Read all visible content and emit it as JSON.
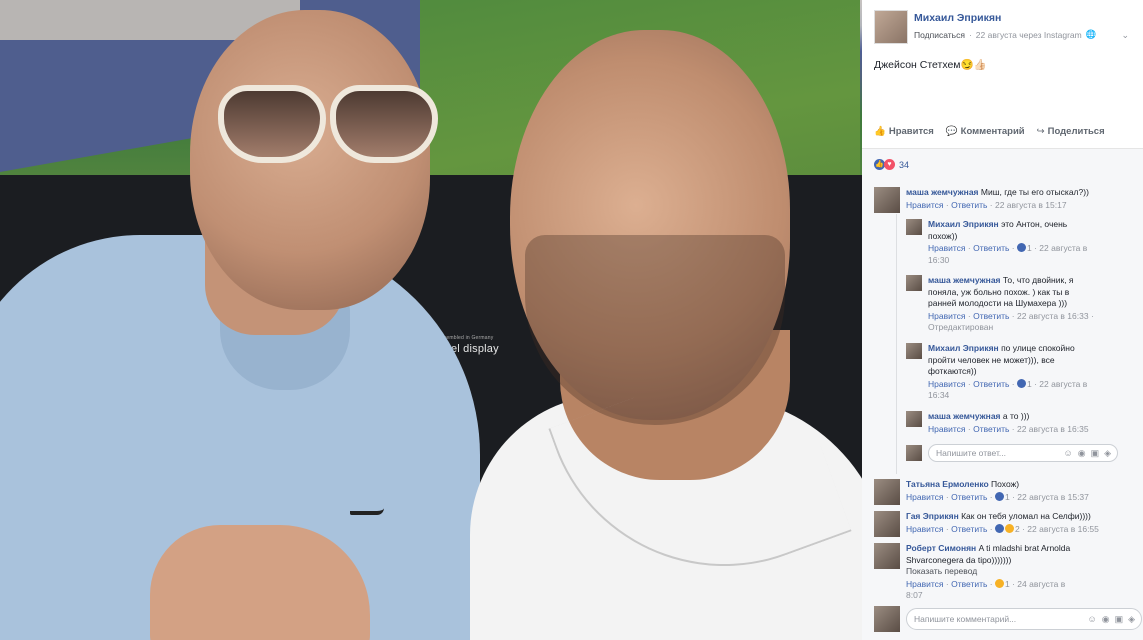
{
  "photo": {
    "screen_brand_small": "assembled in Germany",
    "screen_brand": "engel display"
  },
  "post": {
    "author": "Михаил Эприкян",
    "subscribe": "Подписаться",
    "meta_time": "22 августа через Instagram",
    "meta_sep": "·",
    "text": "Джейсон Стетхем😏👍🏻",
    "like_label": "Нравится",
    "comment_label": "Комментарий",
    "share_label": "Поделиться",
    "likes_count": "34"
  },
  "comments": [
    {
      "who": "маша жемчужная",
      "text": "Миш, где ты его отыскал?))",
      "like": "Нравится",
      "reply": "Ответить",
      "time": "22 августа в 15:17"
    },
    {
      "who": "Михаил Эприкян",
      "text": "это Антон, очень похож))",
      "like": "Нравится",
      "reply": "Ответить",
      "count": "1",
      "time": "22 августа в 16:30"
    },
    {
      "who": "маша жемчужная",
      "text": "То, что двойник, я поняла, уж больно похож. ) как ты в ранней молодости на Шумахера )))",
      "like": "Нравится",
      "reply": "Ответить",
      "time": "22 августа в 16:33",
      "edited": "Отредактирован"
    },
    {
      "who": "Михаил Эприкян",
      "text": "по улице спокойно пройти человек не может))), все фоткаются))",
      "like": "Нравится",
      "reply": "Ответить",
      "count": "1",
      "time": "22 августа в 16:34"
    },
    {
      "who": "маша жемчужная",
      "text": "а то )))",
      "like": "Нравится",
      "reply": "Ответить",
      "time": "22 августа в 16:35"
    },
    {
      "who": "Татьяна Ермоленко",
      "text": "Похож)",
      "like": "Нравится",
      "reply": "Ответить",
      "count": "1",
      "time": "22 августа в 15:37"
    },
    {
      "who": "Гая Эприкян",
      "text": "Как он тебя уломал на Селфи))))",
      "like": "Нравится",
      "reply": "Ответить",
      "count": "2",
      "time": "22 августа в 16:55"
    },
    {
      "who": "Роберт Симонян",
      "text": "A ti mladshi brat Arnolda Shvarconegera da tipo)))))))",
      "translate": "Показать перевод",
      "like": "Нравится",
      "reply": "Ответить",
      "count": "1",
      "time": "24 августа в 8:07"
    }
  ],
  "reply_input": {
    "placeholder": "Напишите ответ..."
  },
  "comment_input": {
    "placeholder": "Напишите комментарий..."
  }
}
